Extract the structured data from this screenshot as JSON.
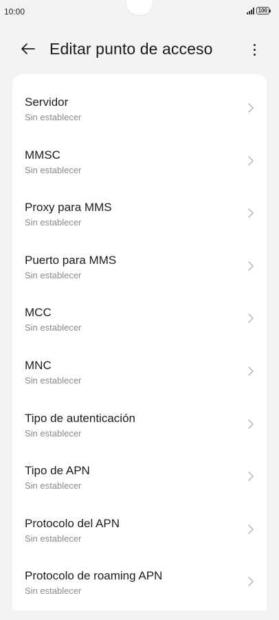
{
  "status_bar": {
    "time": "10:00",
    "battery": "100"
  },
  "header": {
    "title": "Editar punto de acceso",
    "back_icon": "arrow-left-icon",
    "more_icon": "more-vertical-icon"
  },
  "items": [
    {
      "title": "Servidor",
      "subtitle": "Sin establecer"
    },
    {
      "title": "MMSC",
      "subtitle": "Sin establecer"
    },
    {
      "title": "Proxy para MMS",
      "subtitle": "Sin establecer"
    },
    {
      "title": "Puerto para MMS",
      "subtitle": "Sin establecer"
    },
    {
      "title": "MCC",
      "subtitle": "Sin establecer"
    },
    {
      "title": "MNC",
      "subtitle": "Sin establecer"
    },
    {
      "title": "Tipo de autenticación",
      "subtitle": "Sin establecer"
    },
    {
      "title": "Tipo de APN",
      "subtitle": "Sin establecer"
    },
    {
      "title": "Protocolo del APN",
      "subtitle": "Sin establecer"
    },
    {
      "title": "Protocolo de roaming APN",
      "subtitle": "Sin establecer"
    }
  ],
  "colors": {
    "background": "#f3f3f3",
    "card": "#ffffff",
    "title_text": "#1c1c1c",
    "subtitle_text": "#8a8a8a",
    "chevron": "#b5b5b5"
  }
}
